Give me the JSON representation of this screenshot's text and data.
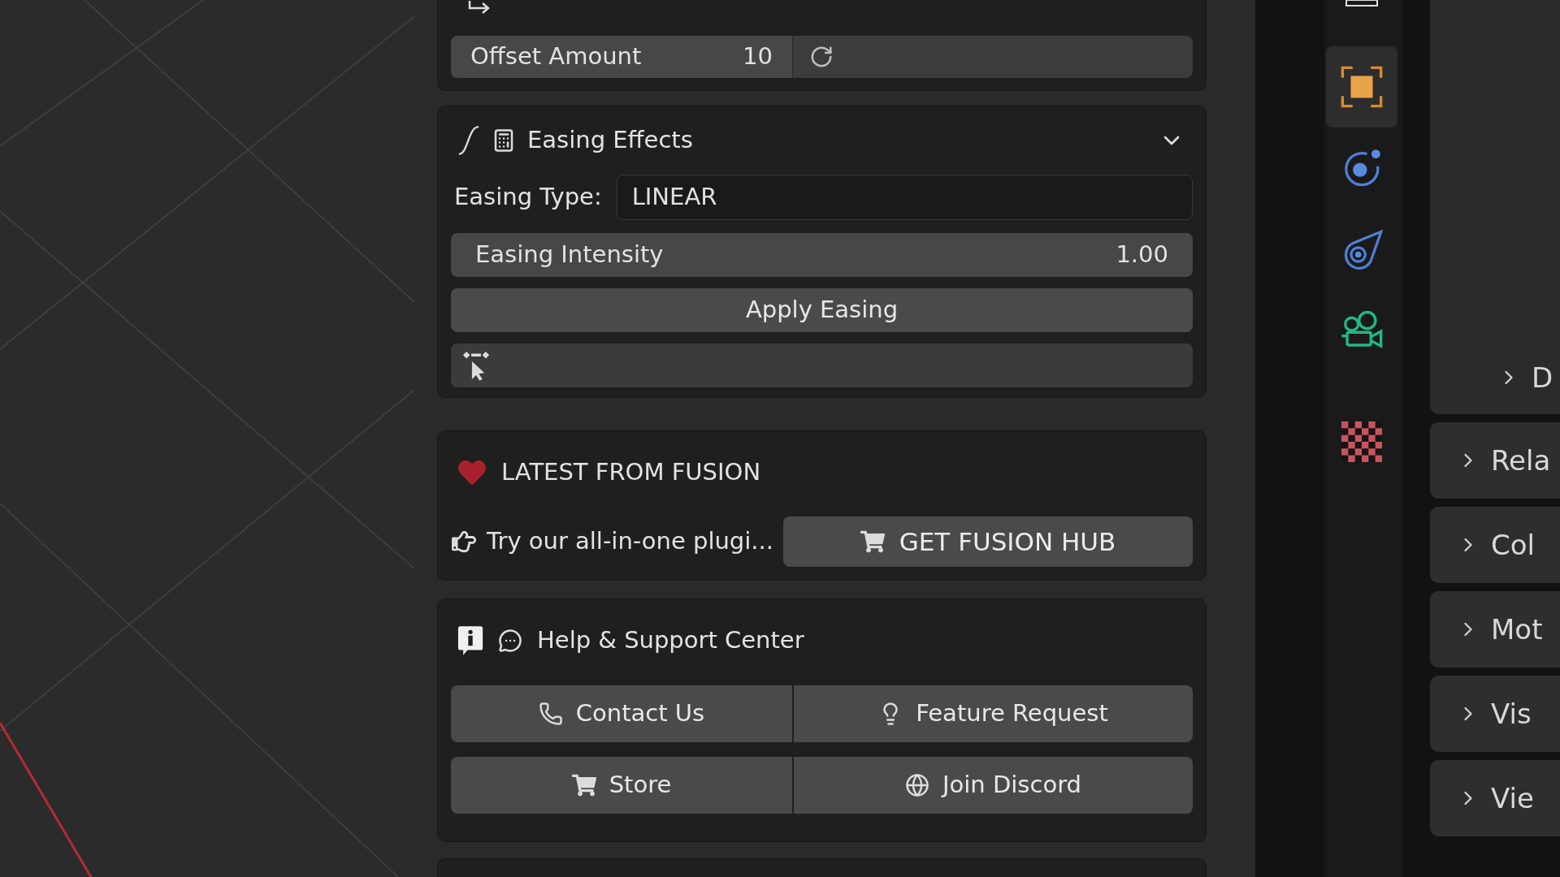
{
  "sidebar": {
    "offset_section": {
      "offset_field": {
        "label": "Offset Amount",
        "value": "10"
      }
    },
    "easing_section": {
      "title": "Easing Effects",
      "expanded": true,
      "type_label": "Easing Type:",
      "type_dropdown": {
        "value": "LINEAR"
      },
      "intensity_field": {
        "label": "Easing Intensity",
        "value": "1.00"
      },
      "apply_button": {
        "label": "Apply Easing"
      }
    },
    "fusion_section": {
      "title": "LATEST FROM FUSION",
      "tagline": "Try our all-in-one plugi...",
      "hub_button": {
        "label": "GET FUSION HUB"
      }
    },
    "help_section": {
      "title": "Help & Support Center",
      "buttons": [
        {
          "label": "Contact Us"
        },
        {
          "label": "Feature Request"
        },
        {
          "label": "Store"
        },
        {
          "label": "Join Discord"
        }
      ]
    }
  },
  "property_tabs": [
    {
      "selected": false
    },
    {
      "selected": true
    },
    {
      "selected": false
    },
    {
      "selected": false
    },
    {
      "selected": false
    },
    {
      "selected": false
    }
  ],
  "properties_panel": {
    "subsections": [
      {
        "title": "D",
        "expanded": false
      }
    ],
    "sections": [
      {
        "title": "Rela",
        "expanded": false
      },
      {
        "title": "Col",
        "expanded": false
      },
      {
        "title": "Mot",
        "expanded": false
      },
      {
        "title": "Vis",
        "expanded": false
      },
      {
        "title": "Vie",
        "expanded": false
      }
    ]
  }
}
